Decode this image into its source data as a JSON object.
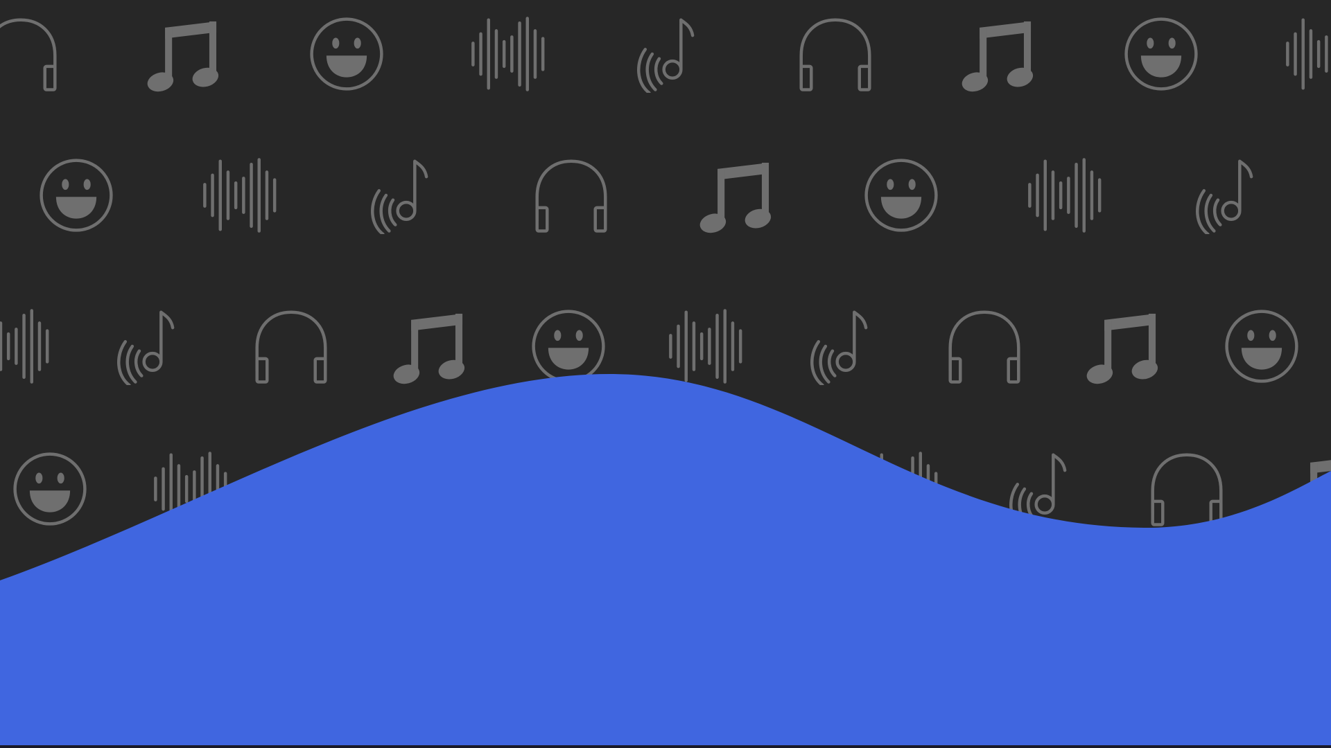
{
  "background": {
    "base_color": "#272727",
    "icon_color": "#6f6f6f",
    "wave_color": "#4066e0",
    "icon_sequence": [
      "headphones-icon",
      "music-notes-icon",
      "smiley-face-icon",
      "sound-wave-icon",
      "broadcast-note-icon"
    ]
  }
}
